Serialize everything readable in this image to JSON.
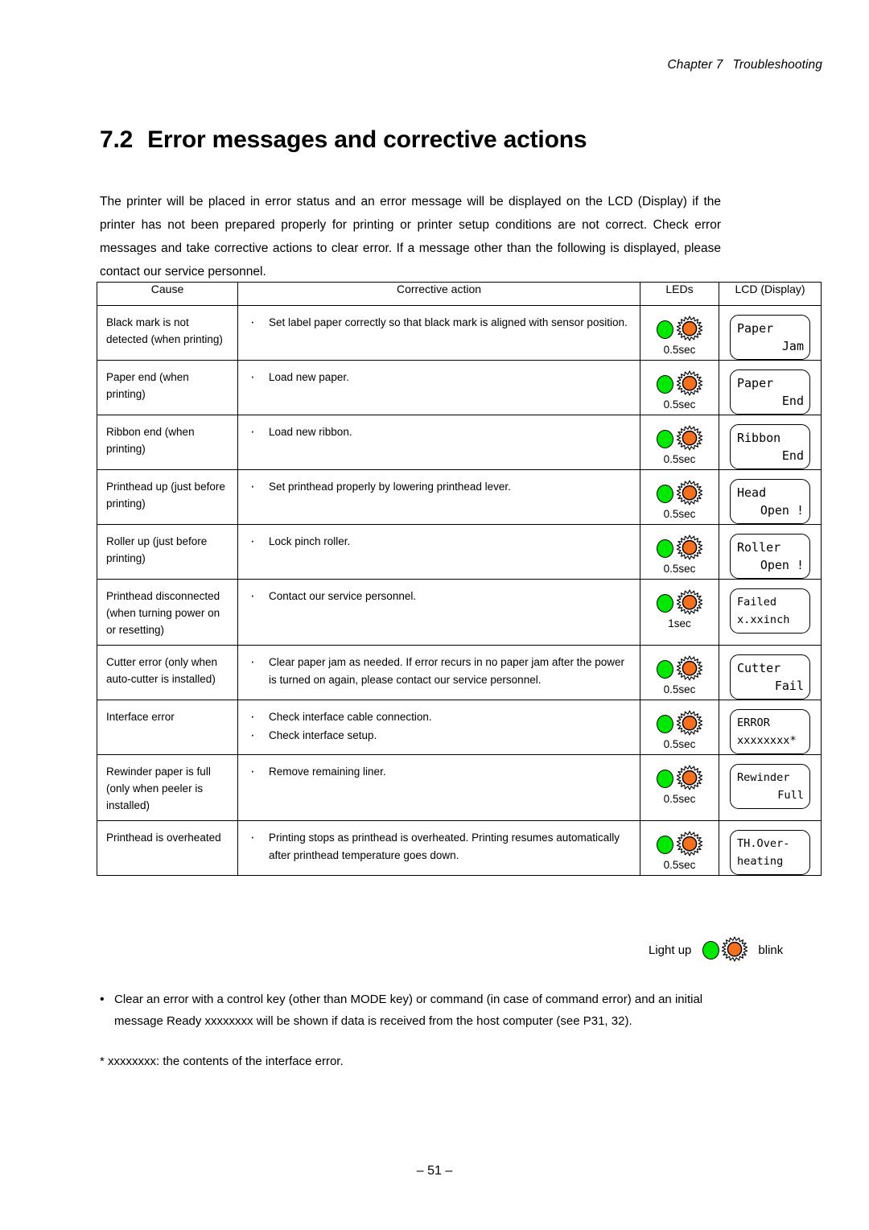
{
  "header": {
    "chapter": "Chapter 7",
    "title": "Troubleshooting"
  },
  "section": {
    "number": "7.2",
    "heading": "Error messages and corrective actions"
  },
  "intro": {
    "paragraph": "The printer will be placed in error status and an error message will be displayed on the LCD (Display) if the printer has not been prepared properly for printing or printer setup conditions are not correct. Check error messages and take corrective actions to clear error. If a message other than the following is displayed, please contact our service personnel."
  },
  "table": {
    "columns": [
      "Cause",
      "Corrective action",
      "LEDs",
      "LCD (Display)"
    ],
    "bullet": "·",
    "rows": [
      {
        "cause": "Black mark is not detected (when printing)",
        "actions": [
          "Set label paper correctly so that black mark is aligned with sensor position."
        ],
        "led_green": "light-up",
        "led_orange": "blink",
        "led_interval": "0.5sec",
        "lcd_line1": "Paper",
        "lcd_line2": "Jam",
        "lcd_line2_align": "right"
      },
      {
        "cause": "Paper end (when printing)",
        "actions": [
          "Load new paper."
        ],
        "led_green": "light-up",
        "led_orange": "blink",
        "led_interval": "0.5sec",
        "lcd_line1": "Paper",
        "lcd_line2": "End",
        "lcd_line2_align": "right"
      },
      {
        "cause": "Ribbon end (when printing)",
        "actions": [
          "Load new ribbon."
        ],
        "led_green": "light-up",
        "led_orange": "blink",
        "led_interval": "0.5sec",
        "lcd_line1": "Ribbon",
        "lcd_line2": "End",
        "lcd_line2_align": "right"
      },
      {
        "cause": "Printhead up (just before printing)",
        "actions": [
          "Set printhead properly by lowering printhead lever."
        ],
        "led_green": "light-up",
        "led_orange": "blink",
        "led_interval": "0.5sec",
        "lcd_line1": "Head",
        "lcd_line2": "Open !",
        "lcd_line2_align": "right"
      },
      {
        "cause": "Roller up (just before printing)",
        "actions": [
          "Lock pinch roller."
        ],
        "led_green": "light-up",
        "led_orange": "blink",
        "led_interval": "0.5sec",
        "lcd_line1": "Roller",
        "lcd_line2": "Open !",
        "lcd_line2_align": "right"
      },
      {
        "cause": "Printhead disconnected (when turning power on or resetting)",
        "actions": [
          "Contact our service personnel."
        ],
        "led_green": "light-up",
        "led_orange": "blink",
        "led_interval": "1sec",
        "lcd_line1": "Failed",
        "lcd_line2": "x.xxinch",
        "lcd_line2_align": "left"
      },
      {
        "cause": "Cutter error (only when auto-cutter is installed)",
        "actions": [
          "Clear paper jam as needed. If error recurs in no paper jam after the power is turned on again, please contact our service personnel."
        ],
        "led_green": "light-up",
        "led_orange": "blink",
        "led_interval": "0.5sec",
        "lcd_line1": "Cutter",
        "lcd_line2": "Fail",
        "lcd_line2_align": "right"
      },
      {
        "cause": "Interface error",
        "actions": [
          "Check interface cable connection.",
          "Check interface setup."
        ],
        "led_green": "light-up",
        "led_orange": "blink",
        "led_interval": "0.5sec",
        "lcd_line1": "ERROR",
        "lcd_line2": "xxxxxxxx*",
        "lcd_line2_align": "left"
      },
      {
        "cause": "Rewinder paper is full (only when peeler is installed)",
        "actions": [
          "Remove remaining liner."
        ],
        "led_green": "light-up",
        "led_orange": "blink",
        "led_interval": "0.5sec",
        "lcd_line1": "Rewinder",
        "lcd_line2": "Full",
        "lcd_line2_align": "right"
      },
      {
        "cause": "Printhead is overheated",
        "actions": [
          "Printing stops as printhead is overheated. Printing resumes automatically after printhead temperature goes down."
        ],
        "led_green": "light-up",
        "led_orange": "blink",
        "led_interval": "0.5sec",
        "lcd_line1": "TH.Over-",
        "lcd_line2": "heating",
        "lcd_line2_align": "left"
      }
    ]
  },
  "legend": {
    "light_up_label": "Light up",
    "blink_label": "blink"
  },
  "notes": {
    "bullet": "•",
    "bullet_note": "Clear an error with a control key (other than MODE key) or command (in case of command error) and an initial message  Ready xxxxxxxx  will be shown if data is received from the host computer (see P31, 32).",
    "star_note": "* xxxxxxxx: the contents of the interface error."
  },
  "footer": {
    "page_number": "– 51 –"
  },
  "colors": {
    "led_green": "#00e800",
    "led_orange": "#f4701e",
    "rule": "#000000"
  }
}
